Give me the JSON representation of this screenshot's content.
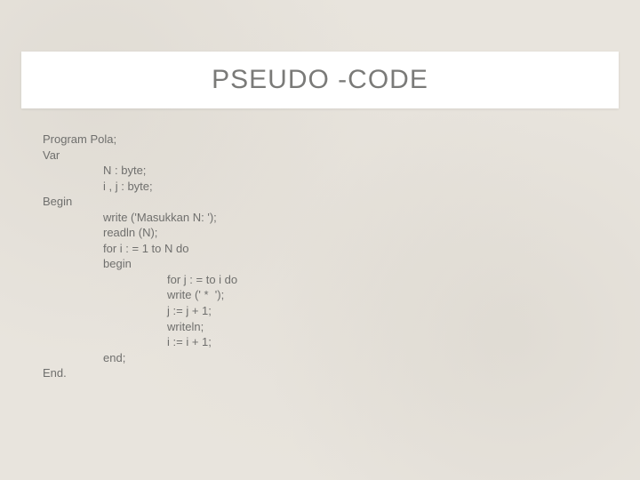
{
  "title": "PSEUDO -CODE",
  "code": {
    "l0": "Program Pola;",
    "l1": "Var",
    "l2": "N : byte;",
    "l3": "i , j : byte;",
    "l4": "Begin",
    "l5": "write ('Masukkan N: ');",
    "l6": "readln (N);",
    "l7": "for i : = 1 to N do",
    "l8": "begin",
    "l9": "for j : = to i do",
    "l10": "write (' *  ');",
    "l11": "j := j + 1;",
    "l12": "writeln;",
    "l13": "i := i + 1;",
    "l14": "end;",
    "l15": "End."
  }
}
